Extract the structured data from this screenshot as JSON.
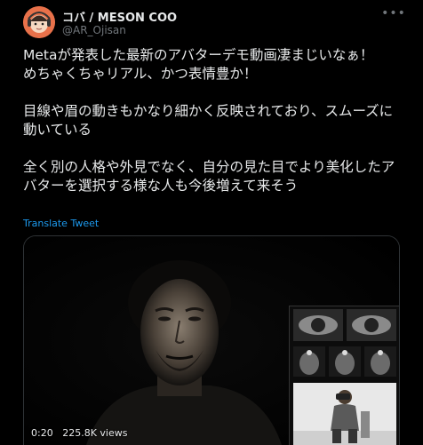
{
  "author": {
    "display_name": "コバ / MESON COO",
    "handle": "@AR_Ojisan"
  },
  "tweet": {
    "paragraphs": [
      "Metaが発表した最新のアバターデモ動画凄まじいなぁ！\nめちゃくちゃリアル、かつ表情豊か！",
      "目線や眉の動きもかなり細かく反映されており、スムーズに動いている",
      "全く別の人格や外見でなく、自分の見た目でより美化したアバターを選択する様な人も今後増えて来そう"
    ],
    "translate_label": "Translate Tweet"
  },
  "video": {
    "time": "0:20",
    "views": "225.8K views"
  },
  "icons": {
    "more": "more-horizontal-icon"
  }
}
